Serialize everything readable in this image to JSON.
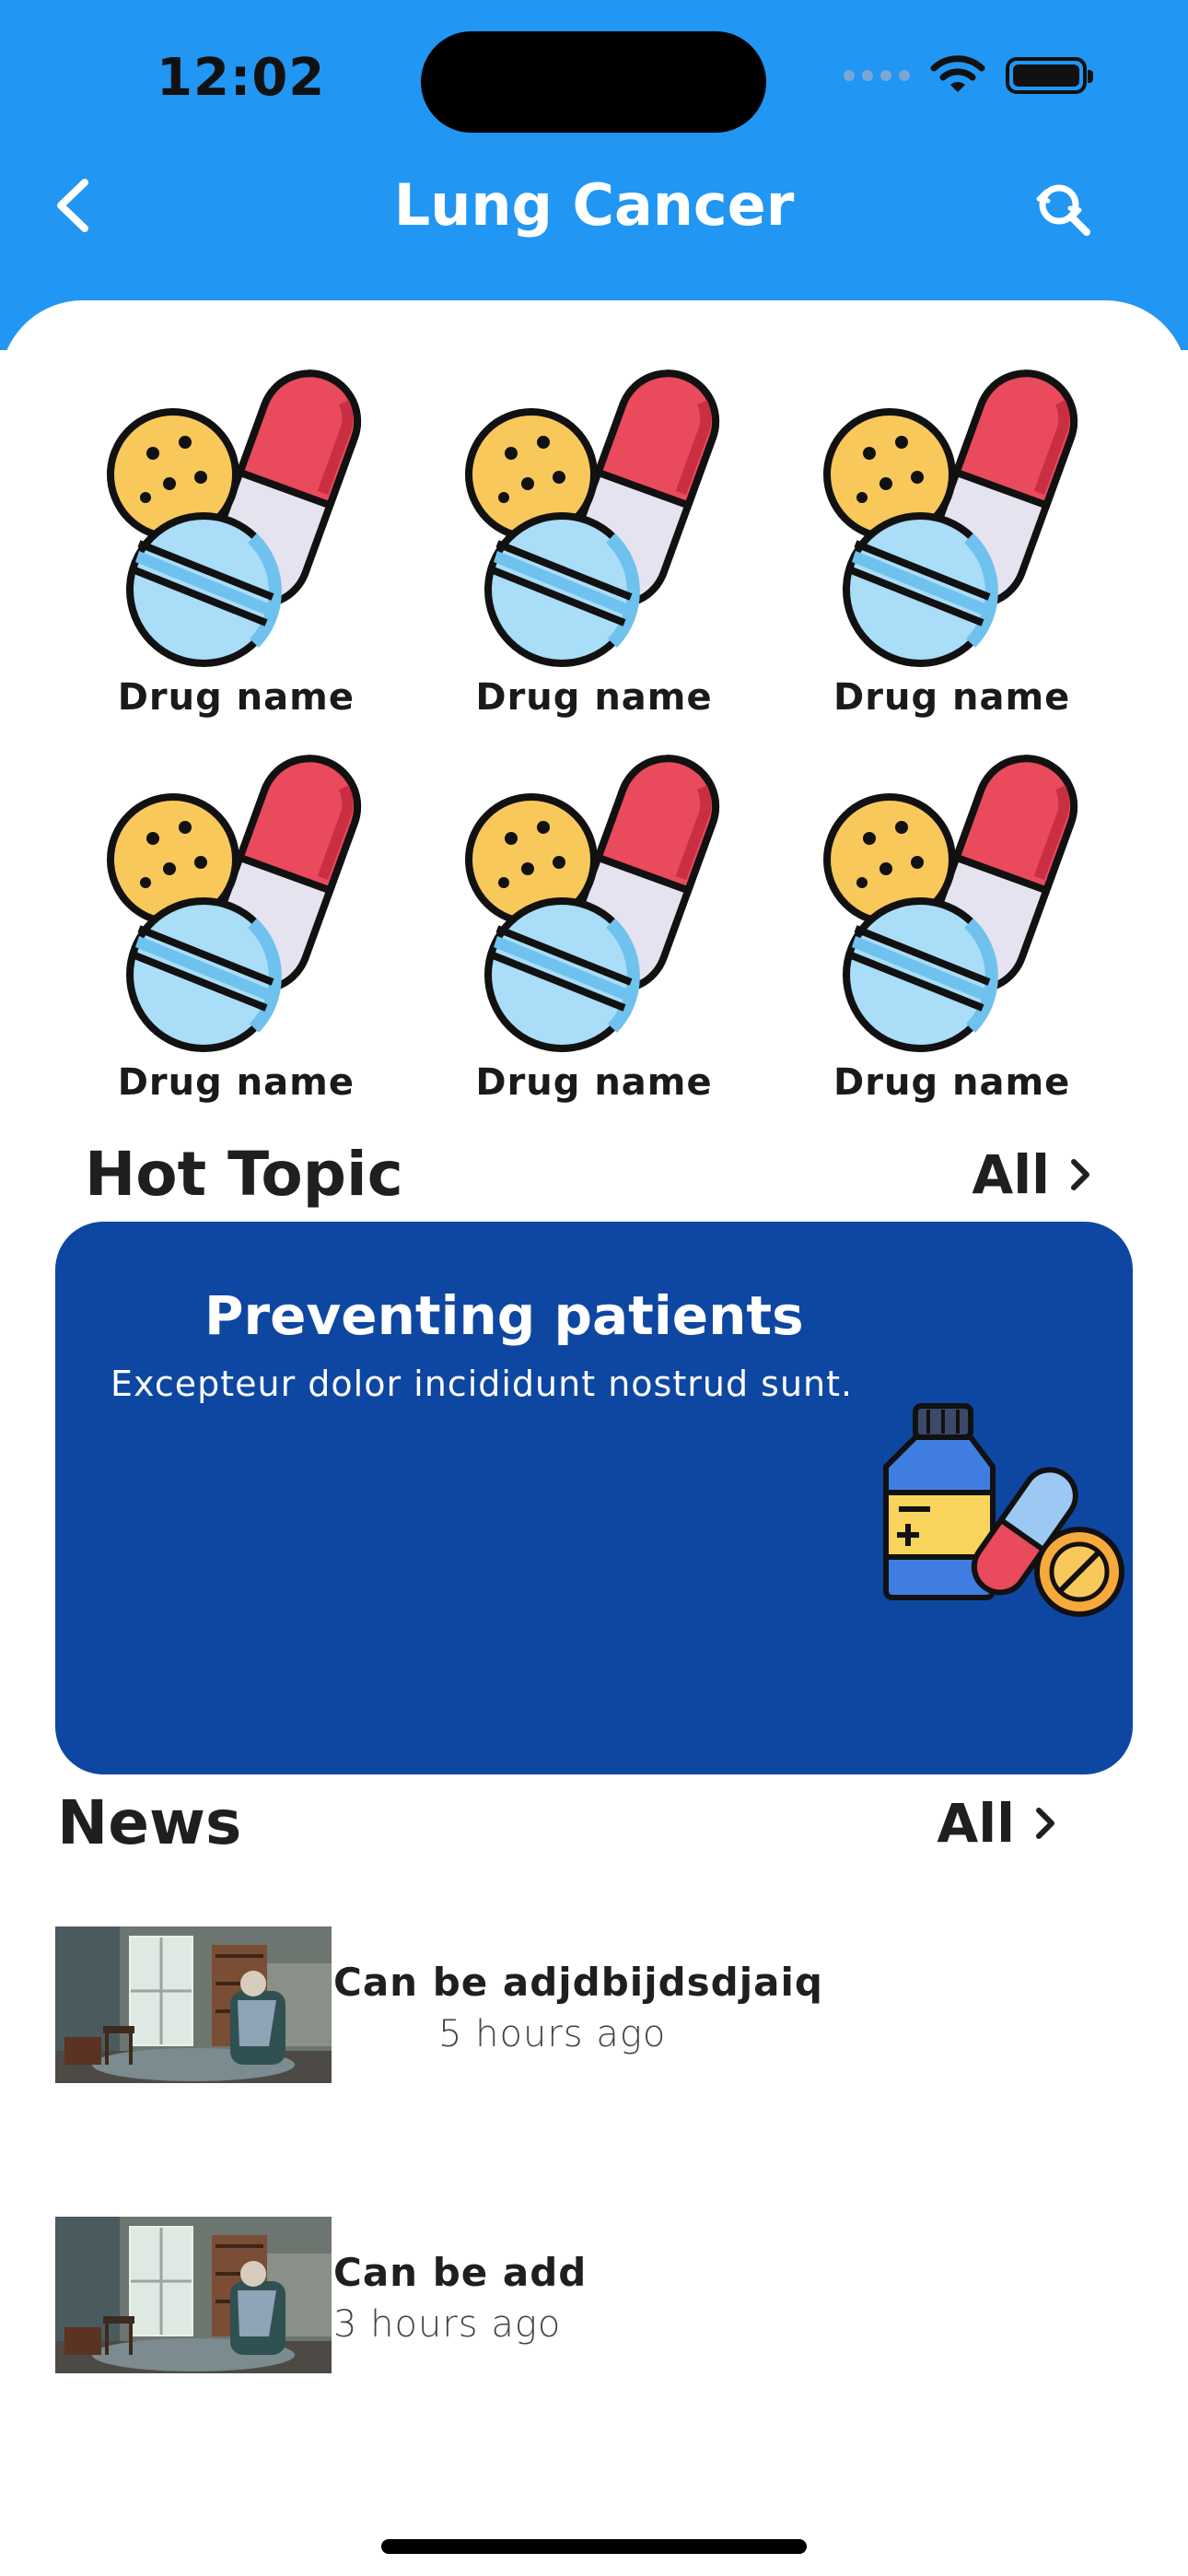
{
  "status_bar": {
    "time": "12:02"
  },
  "header": {
    "title": "Lung Cancer",
    "back_icon": "chevron-left-icon",
    "search_icon": "refresh-search-icon"
  },
  "drugs": [
    {
      "label": "Drug name"
    },
    {
      "label": "Drug name"
    },
    {
      "label": "Drug name"
    },
    {
      "label": "Drug name"
    },
    {
      "label": "Drug name"
    },
    {
      "label": "Drug name"
    }
  ],
  "hot_topic": {
    "section_title": "Hot Topic",
    "all_label": "All",
    "card": {
      "title": "Preventing patients",
      "subtitle": "Excepteur dolor incididunt nostrud sunt."
    }
  },
  "news": {
    "section_title": "News",
    "all_label": "All",
    "items": [
      {
        "title": "Can be adjdbijdsdjaiq",
        "time": "5 hours ago"
      },
      {
        "title": "Can be add",
        "time": "3 hours ago"
      }
    ]
  },
  "colors": {
    "header": "#2196F3",
    "card": "#0E47A1"
  }
}
